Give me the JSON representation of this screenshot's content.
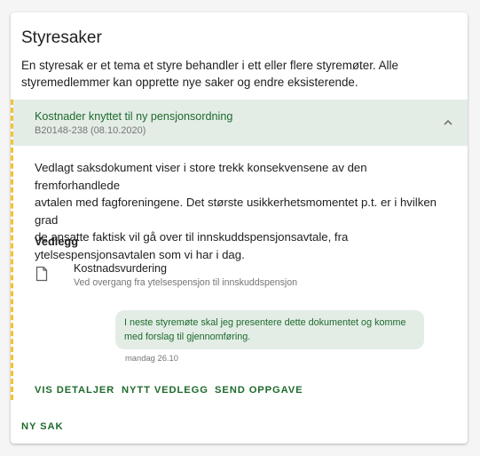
{
  "board_matters": {
    "title": "Styresaker",
    "intro_line1": "En styresak er et tema et styre behandler i ett eller flere styremøter. Alle",
    "intro_line2": "styremedlemmer kan opprette nye saker og endre eksisterende."
  },
  "case": {
    "title": "Kostnader knyttet til ny pensjonsordning",
    "meta": "B20148-238 (08.10.2020)",
    "expanded": true,
    "description_lines": [
      "Vedlagt saksdokument viser i store trekk konsekvensene av den fremforhandlede",
      "avtalen med fagforeningene. Det største usikkerhetsmomentet p.t. er i hvilken grad",
      "de ansatte faktisk vil gå over til innskuddspensjonsavtale, fra",
      "ytelsespensjonsavtalen som vi har i dag."
    ],
    "attachments_heading": "Vedlegg",
    "attachment": {
      "icon": "document-icon",
      "name": "Kostnadsvurdering",
      "subtitle": "Ved overgang fra ytelsespensjon til innskuddspensjon"
    },
    "comment": {
      "line1": "I neste styremøte skal jeg presentere dette dokumentet og komme",
      "line2": "med forslag til gjennomføring.",
      "time": "mandag 26.10"
    },
    "actions": {
      "details": "VIS DETALJER",
      "new_attachment": "NYTT VEDLEGG",
      "send_task": "SEND OPPGAVE"
    }
  },
  "footer": {
    "new_case": "NY SAK"
  },
  "colors": {
    "accent_green": "#1e6a2c",
    "header_bg": "#e3ede6",
    "dashed_marker": "#f2c230"
  }
}
